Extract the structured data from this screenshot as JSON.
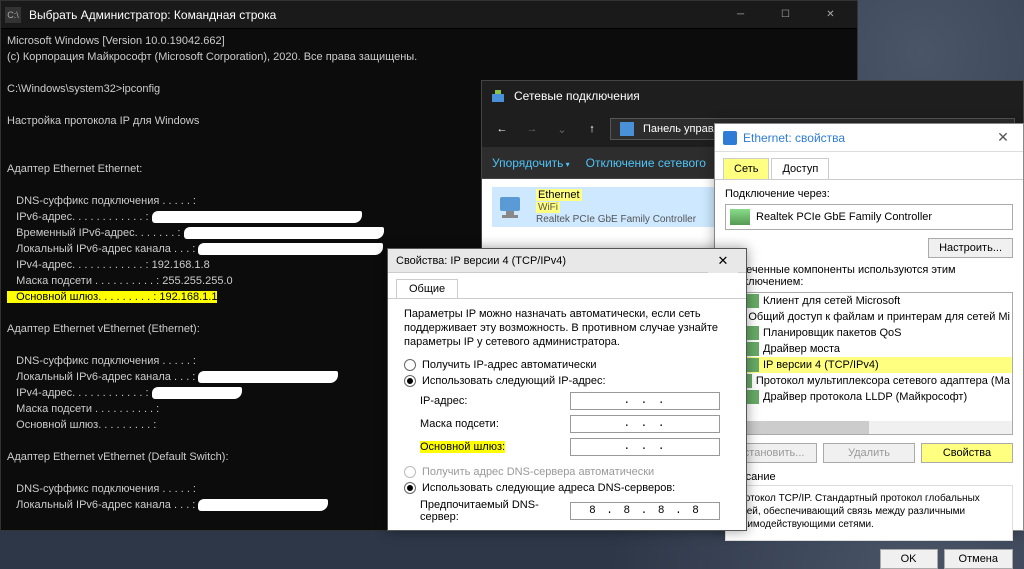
{
  "cmd": {
    "title": "Выбрать Администратор: Командная строка",
    "l1": "Microsoft Windows [Version 10.0.19042.662]",
    "l2": "(c) Корпорация Майкрософт (Microsoft Corporation), 2020. Все права защищены.",
    "prompt": "C:\\Windows\\system32>ipconfig",
    "hdr": "Настройка протокола IP для Windows",
    "a1": "Адаптер Ethernet Ethernet:",
    "dns": "   DNS-суффикс подключения . . . . . :",
    "ipv6a": "   IPv6-адрес. . . . . . . . . . . . : ",
    "tmpv6": "   Временный IPv6-адрес. . . . . . . : ",
    "locv6": "   Локальный IPv6-адрес канала . . . : ",
    "ipv4": "   IPv4-адрес. . . . . . . . . . . . : 192.168.1.8",
    "mask": "   Маска подсети . . . . . . . . . . : 255.255.255.0",
    "gw_l": "   Основной шлюз. . . . . . . . . : ",
    "gw_v": "192.168.1.1",
    "a2": "Адаптер Ethernet vEthernet (Ethernet):",
    "ipv4b": "   IPv4-адрес. . . . . . . . . . . . : ",
    "maskb": "   Маска подсети . . . . . . . . . . :",
    "gwb": "   Основной шлюз. . . . . . . . . :",
    "a3": "Адаптер Ethernet vEthernet (Default Switch):"
  },
  "nc": {
    "title": "Сетевые подключения",
    "crumb": "Панель управления",
    "tool1": "Упорядочить",
    "tool2": "Отключение сетевого",
    "item_name": "Ethernet",
    "item_sub1": "WiFi",
    "item_sub2": "Realtek PCIe GbE Family Controller"
  },
  "ep": {
    "title": "Ethernet: свойства",
    "tab1": "Сеть",
    "tab2": "Доступ",
    "conn_via": "Подключение через:",
    "adapter": "Realtek PCIe GbE Family Controller",
    "configure": "Настроить...",
    "comp_hdr": "Отмеченные компоненты используются этим подключением:",
    "c0": "Клиент для сетей Microsoft",
    "c1": "Общий доступ к файлам и принтерам для сетей Mi",
    "c2": "Планировщик пакетов QoS",
    "c3": "Драйвер моста",
    "c4": "IP версии 4 (TCP/IPv4)",
    "c5": "Протокол мультиплексора сетевого адаптера (Ма",
    "c6": "Драйвер протокола LLDP (Майкрософт)",
    "install": "Установить...",
    "remove": "Удалить",
    "props": "Свойства",
    "desc_lbl": "Описание",
    "desc": "Протокол TCP/IP. Стандартный протокол глобальных сетей, обеспечивающий связь между различными взаимодействующими сетями.",
    "ok": "OK",
    "cancel": "Отмена"
  },
  "iv": {
    "title": "Свойства: IP версии 4 (TCP/IPv4)",
    "tab": "Общие",
    "info": "Параметры IP можно назначать автоматически, если сеть поддерживает эту возможность. В противном случае узнайте параметры IP у сетевого администратора.",
    "r1": "Получить IP-адрес автоматически",
    "r2": "Использовать следующий IP-адрес:",
    "f1": "IP-адрес:",
    "f2": "Маска подсети:",
    "f3": "Основной шлюз:",
    "dots": ".     .     .",
    "r3": "Получить адрес DNS-сервера автоматически",
    "r4": "Использовать следующие адреса DNS-серверов:",
    "f4": "Предпочитаемый DNS-сервер:",
    "dns1": "8  .  8  .  8  .  8"
  }
}
